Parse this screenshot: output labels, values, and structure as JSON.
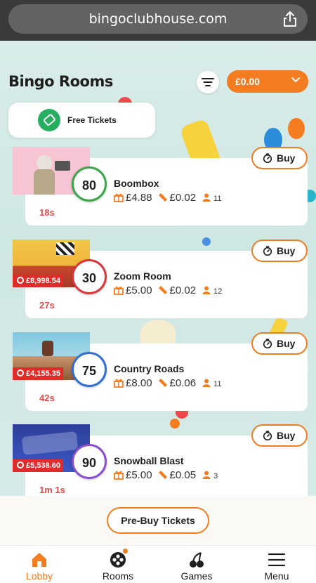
{
  "browser": {
    "url": "bingoclubhouse.com"
  },
  "header": {
    "title": "Bingo Rooms",
    "balance": "£0.00"
  },
  "free_tickets": {
    "label": "Free Tickets"
  },
  "rooms": [
    {
      "name": "Boombox",
      "ball_number": "80",
      "ball_color": "#3aa64a",
      "prize": "£4.88",
      "ticket_price": "£0.02",
      "players": "11",
      "countdown": "18s",
      "jackpot": "",
      "buy_label": "Buy"
    },
    {
      "name": "Zoom Room",
      "ball_number": "30",
      "ball_color": "#d9363e",
      "prize": "£5.00",
      "ticket_price": "£0.02",
      "players": "12",
      "countdown": "27s",
      "jackpot": "£8,998.54",
      "buy_label": "Buy"
    },
    {
      "name": "Country Roads",
      "ball_number": "75",
      "ball_color": "#2f6fd6",
      "prize": "£8.00",
      "ticket_price": "£0.06",
      "players": "11",
      "countdown": "42s",
      "jackpot": "£4,155.35",
      "buy_label": "Buy"
    },
    {
      "name": "Snowball Blast",
      "ball_number": "90",
      "ball_color": "#8a4fcf",
      "prize": "£5.00",
      "ticket_price": "£0.05",
      "players": "3",
      "countdown": "1m 1s",
      "jackpot": "£5,538.60",
      "buy_label": "Buy"
    }
  ],
  "prebuy": {
    "label": "Pre-Buy Tickets"
  },
  "nav": [
    {
      "label": "Lobby",
      "icon": "house-icon",
      "active": true
    },
    {
      "label": "Rooms",
      "icon": "bingo-balls-icon",
      "active": false
    },
    {
      "label": "Games",
      "icon": "cherries-icon",
      "active": false
    },
    {
      "label": "Menu",
      "icon": "hamburger-icon",
      "active": false
    }
  ],
  "colors": {
    "accent": "#f47c20",
    "jackpot": "#e02b2b",
    "countdown": "#e84a4a",
    "free_ticket": "#27ae60"
  }
}
